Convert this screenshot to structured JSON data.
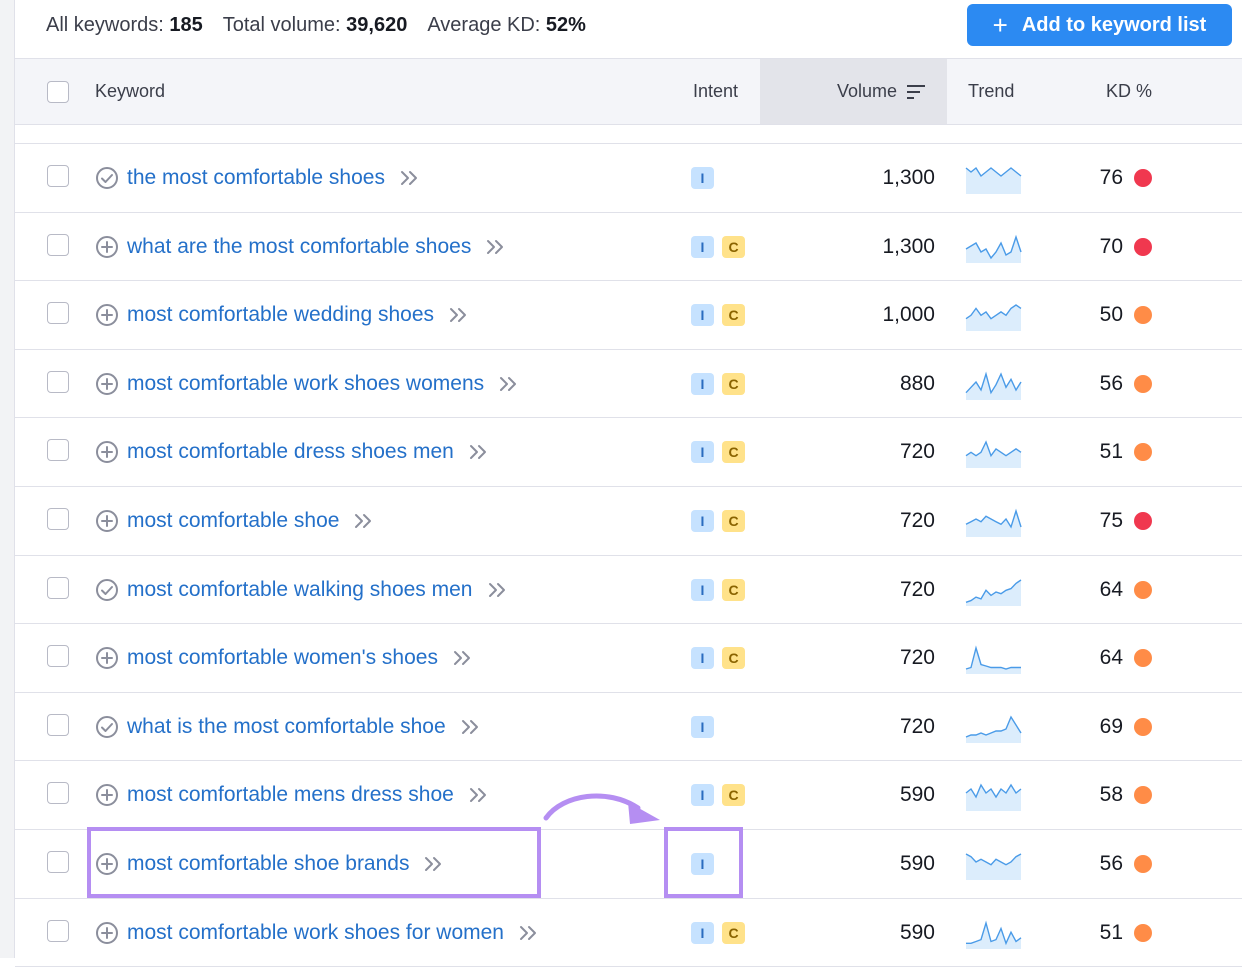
{
  "summary": {
    "all_keywords_label": "All keywords:",
    "all_keywords_value": "185",
    "total_volume_label": "Total volume:",
    "total_volume_value": "39,620",
    "avg_kd_label": "Average KD:",
    "avg_kd_value": "52%"
  },
  "add_button": {
    "icon": "plus-icon",
    "label": "Add to keyword list"
  },
  "columns": {
    "keyword": "Keyword",
    "intent": "Intent",
    "volume": "Volume",
    "trend": "Trend",
    "kd": "KD %"
  },
  "colors": {
    "accent": "#2c8af2",
    "link": "#2470c9",
    "kd_red": "#f0384f",
    "kd_orange": "#ff8c47",
    "highlight": "#b58ef2",
    "intent_i": "#c6e2ff",
    "intent_c": "#ffe28a"
  },
  "rows": [
    {
      "keyword": "the most comfortable shoes",
      "status_icon": "check-circle-icon",
      "intents": [
        "I"
      ],
      "volume": "1,300",
      "kd": "76",
      "kd_level": "red",
      "trend": [
        6,
        5,
        6,
        4,
        5,
        6,
        5,
        4,
        5,
        6,
        5,
        4
      ]
    },
    {
      "keyword": "what are the most comfortable shoes",
      "status_icon": "plus-circle-icon",
      "intents": [
        "I",
        "C"
      ],
      "volume": "1,300",
      "kd": "70",
      "kd_level": "red",
      "trend": [
        4,
        5,
        6,
        3,
        4,
        1,
        3,
        6,
        2,
        3,
        8,
        3
      ]
    },
    {
      "keyword": "most comfortable wedding shoes",
      "status_icon": "plus-circle-icon",
      "intents": [
        "I",
        "C"
      ],
      "volume": "1,000",
      "kd": "50",
      "kd_level": "orange",
      "trend": [
        3,
        4,
        6,
        4,
        5,
        3,
        4,
        5,
        4,
        6,
        7,
        6
      ]
    },
    {
      "keyword": "most comfortable work shoes womens",
      "status_icon": "plus-circle-icon",
      "intents": [
        "I",
        "C"
      ],
      "volume": "880",
      "kd": "56",
      "kd_level": "orange",
      "trend": [
        2,
        4,
        6,
        3,
        9,
        2,
        5,
        9,
        4,
        7,
        3,
        6
      ]
    },
    {
      "keyword": "most comfortable dress shoes men",
      "status_icon": "plus-circle-icon",
      "intents": [
        "I",
        "C"
      ],
      "volume": "720",
      "kd": "51",
      "kd_level": "orange",
      "trend": [
        3,
        4,
        3,
        4,
        7,
        3,
        5,
        4,
        3,
        4,
        5,
        4
      ]
    },
    {
      "keyword": "most comfortable shoe",
      "status_icon": "plus-circle-icon",
      "intents": [
        "I",
        "C"
      ],
      "volume": "720",
      "kd": "75",
      "kd_level": "red",
      "trend": [
        4,
        5,
        6,
        5,
        7,
        6,
        5,
        4,
        6,
        3,
        9,
        3
      ]
    },
    {
      "keyword": "most comfortable walking shoes men",
      "status_icon": "check-circle-icon",
      "intents": [
        "I",
        "C"
      ],
      "volume": "720",
      "kd": "64",
      "kd_level": "orange",
      "trend": [
        1,
        2,
        4,
        3,
        8,
        5,
        7,
        6,
        8,
        9,
        12,
        14
      ]
    },
    {
      "keyword": "most comfortable women's shoes",
      "status_icon": "plus-circle-icon",
      "intents": [
        "I",
        "C"
      ],
      "volume": "720",
      "kd": "64",
      "kd_level": "orange",
      "trend": [
        2,
        3,
        16,
        5,
        4,
        3,
        3,
        3,
        2,
        3,
        3,
        3
      ]
    },
    {
      "keyword": "what is the most comfortable shoe",
      "status_icon": "check-circle-icon",
      "intents": [
        "I"
      ],
      "volume": "720",
      "kd": "69",
      "kd_level": "orange",
      "trend": [
        2,
        3,
        3,
        4,
        3,
        4,
        5,
        5,
        6,
        12,
        8,
        4
      ]
    },
    {
      "keyword": "most comfortable mens dress shoe",
      "status_icon": "plus-circle-icon",
      "intents": [
        "I",
        "C"
      ],
      "volume": "590",
      "kd": "58",
      "kd_level": "orange",
      "trend": [
        4,
        5,
        3,
        6,
        4,
        5,
        3,
        5,
        4,
        6,
        4,
        5
      ]
    },
    {
      "keyword": "most comfortable shoe brands",
      "status_icon": "plus-circle-icon",
      "intents": [
        "I"
      ],
      "volume": "590",
      "kd": "56",
      "kd_level": "orange",
      "trend": [
        9,
        8,
        6,
        7,
        6,
        5,
        7,
        6,
        5,
        6,
        8,
        9
      ]
    },
    {
      "keyword": "most comfortable work shoes for women",
      "status_icon": "plus-circle-icon",
      "intents": [
        "I",
        "C"
      ],
      "volume": "590",
      "kd": "51",
      "kd_level": "orange",
      "trend": [
        2,
        2,
        3,
        4,
        13,
        3,
        4,
        10,
        2,
        8,
        3,
        5
      ]
    }
  ]
}
